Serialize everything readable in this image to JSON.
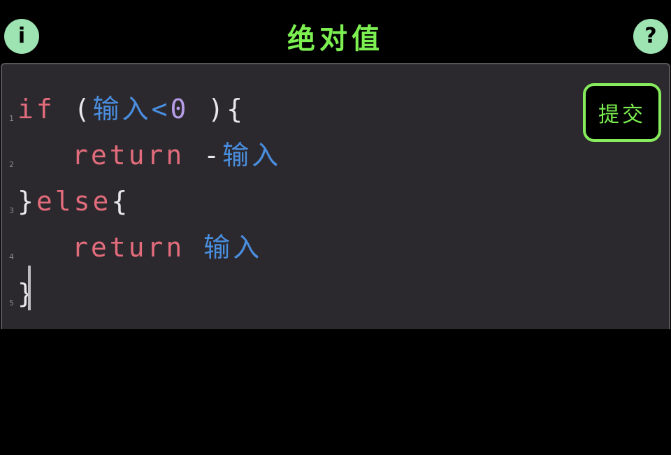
{
  "header": {
    "title": "绝对值",
    "info_icon": "info-icon",
    "info_glyph": "i",
    "help_icon": "help-icon",
    "help_glyph": "?"
  },
  "editor": {
    "lines": [
      {
        "number": "1",
        "tokens": {
          "kw_if": "if",
          "space1": " ",
          "paren_open": "(",
          "var_input": "输入",
          "op_lt": "<",
          "num_zero": "0",
          "space2": " ",
          "paren_close_brace": "){"
        }
      },
      {
        "number": "2",
        "tokens": {
          "kw_return": "return",
          "space1": " ",
          "op_minus": "-",
          "var_input": "输入"
        }
      },
      {
        "number": "3",
        "tokens": {
          "brace_close": "}",
          "kw_else": "else",
          "brace_open": "{"
        }
      },
      {
        "number": "4",
        "tokens": {
          "kw_return": "return",
          "space1": " ",
          "var_input": "输入"
        }
      },
      {
        "number": "5",
        "tokens": {
          "brace_close": "}"
        }
      }
    ]
  },
  "submit": {
    "label": "提交"
  },
  "colors": {
    "accent_green": "#7cf050",
    "keyword": "#e36c7c",
    "variable": "#4a8ee0",
    "number": "#b79de8",
    "editor_bg": "#2b292d",
    "icon_bg": "#9ee3b2"
  }
}
